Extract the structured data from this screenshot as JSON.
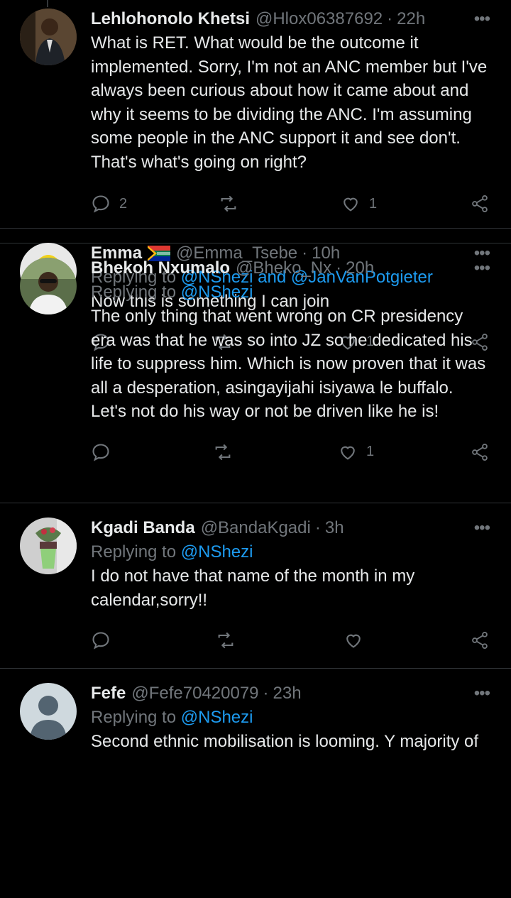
{
  "tweets": [
    {
      "name": "Lehlohonolo Khetsi",
      "handle": "@Hlox06387692",
      "time": "22h",
      "replying_to": null,
      "text": "What is RET. What would be the outcome it implemented. Sorry, I'm not an ANC member but I've always been curious about how it came about and why it seems to be dividing the ANC. I'm assuming some people in the ANC support it and see don't. That's what's going on right?",
      "replies": "2",
      "retweets": "",
      "likes": "1"
    },
    {
      "name": "Emma",
      "handle": "@Emma_Tsebe",
      "time": "10h",
      "replying_prefix": "Replying to ",
      "replying_to": "@NShezi and @JanVanPotgieter",
      "text": "Now this is something I can join",
      "replies": "",
      "retweets": "",
      "likes": "1"
    },
    {
      "name": "Bhekoh Nxumalo",
      "handle": "@Bheko_Nx",
      "time": "20h",
      "replying_prefix": "Replying to ",
      "replying_to": "@NShezi",
      "text": "The only thing that went wrong on CR presidency era was that he was so into JZ so he dedicated his life to suppress him. Which is now proven that it was all a desperation, asingayijahi isiyawa le buffalo. Let's not do his way or not be driven like he is!",
      "replies": "",
      "retweets": "",
      "likes": "1"
    },
    {
      "name": "Kgadi Banda",
      "handle": "@BandaKgadi",
      "time": "3h",
      "replying_prefix": "Replying to ",
      "replying_to": "@NShezi",
      "text": "I do not have that name of the month in my calendar,sorry!!",
      "replies": "",
      "retweets": "",
      "likes": ""
    },
    {
      "name": "Fefe",
      "handle": "@Fefe70420079",
      "time": "23h",
      "replying_prefix": "Replying to ",
      "replying_to": "@NShezi",
      "text": "Second ethnic mobilisation is looming. Y majority of",
      "replies": "",
      "retweets": "",
      "likes": ""
    }
  ],
  "ui": {
    "dot": "·",
    "more": "•••"
  },
  "colors": {
    "background": "#000000",
    "text": "#e7e9ea",
    "muted": "#71767b",
    "link": "#1d9bf0",
    "divider": "#2f3336"
  },
  "icons": [
    "reply-icon",
    "retweet-icon",
    "like-icon",
    "share-icon",
    "more-icon",
    "south-africa-flag-icon"
  ]
}
